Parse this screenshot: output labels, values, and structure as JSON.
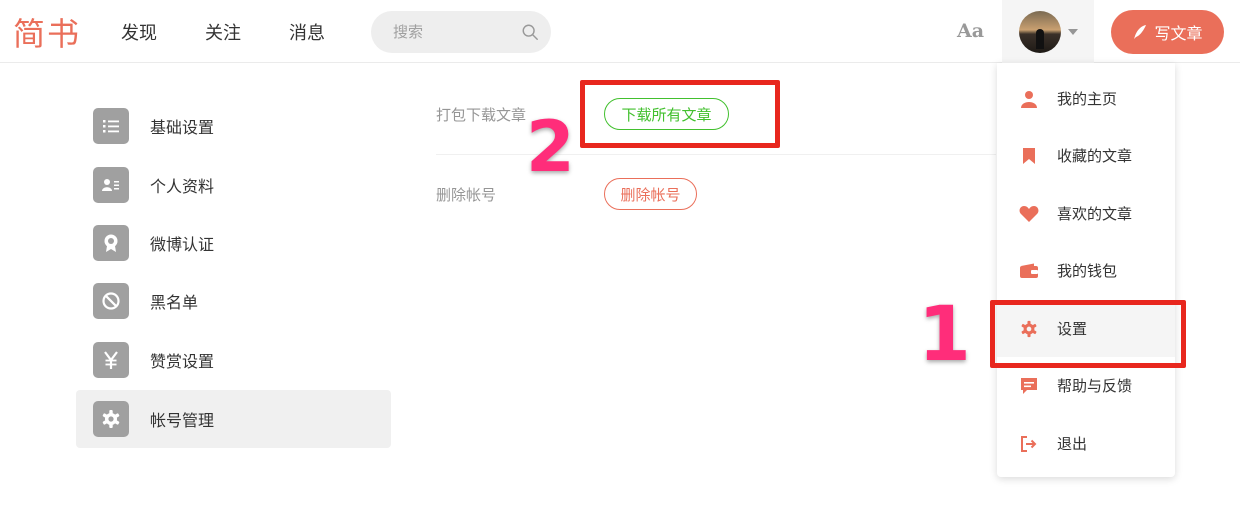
{
  "header": {
    "logo": "简书",
    "nav": [
      "发现",
      "关注",
      "消息"
    ],
    "search_placeholder": "搜索",
    "font_toggle": "Aa",
    "write_label": "写文章",
    "accent_color": "#ea6f5a"
  },
  "sidebar": {
    "items": [
      {
        "label": "基础设置",
        "icon": "list-icon"
      },
      {
        "label": "个人资料",
        "icon": "id-card-icon"
      },
      {
        "label": "微博认证",
        "icon": "badge-icon"
      },
      {
        "label": "黑名单",
        "icon": "ban-icon"
      },
      {
        "label": "赞赏设置",
        "icon": "yen-icon"
      },
      {
        "label": "帐号管理",
        "icon": "gear-icon",
        "active": true
      }
    ]
  },
  "main": {
    "download": {
      "label": "打包下载文章",
      "button": "下载所有文章"
    },
    "delete": {
      "label": "删除帐号",
      "button": "删除帐号"
    }
  },
  "dropdown": {
    "items": [
      {
        "label": "我的主页",
        "icon": "user-icon"
      },
      {
        "label": "收藏的文章",
        "icon": "bookmark-icon"
      },
      {
        "label": "喜欢的文章",
        "icon": "heart-icon"
      },
      {
        "label": "我的钱包",
        "icon": "wallet-icon"
      },
      {
        "label": "设置",
        "icon": "gear-icon",
        "hover": true
      },
      {
        "label": "帮助与反馈",
        "icon": "chat-icon"
      },
      {
        "label": "退出",
        "icon": "logout-icon"
      }
    ]
  },
  "annotations": {
    "step1": "1",
    "step2": "2",
    "box_color": "#e8271e",
    "number_color": "#ff2d7a"
  }
}
